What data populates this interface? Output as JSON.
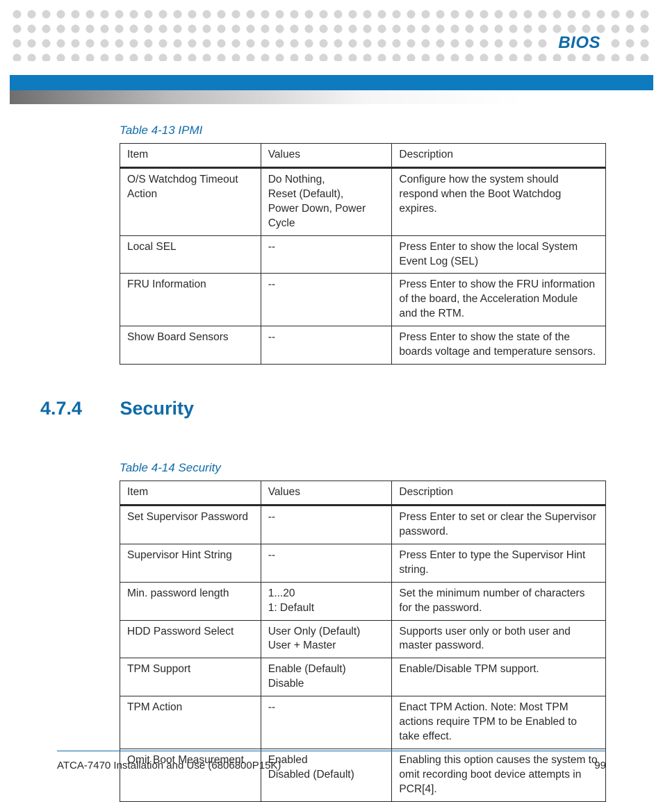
{
  "chapter": "BIOS",
  "section": {
    "number": "4.7.4",
    "title": "Security"
  },
  "table1": {
    "caption": "Table 4-13 IPMI",
    "headers": {
      "c1": "Item",
      "c2": "Values",
      "c3": "Description"
    },
    "rows": [
      {
        "c1": "O/S Watchdog Timeout Action",
        "c2": "Do Nothing,\nReset (Default),\nPower Down, Power Cycle",
        "c3": "Configure how the system should respond when the Boot Watchdog expires."
      },
      {
        "c1": "Local SEL",
        "c2": "--",
        "c3": "Press Enter to show the local System Event Log (SEL)"
      },
      {
        "c1": "FRU Information",
        "c2": "--",
        "c3": "Press Enter to show the FRU information of the board, the Acceleration Module and the RTM."
      },
      {
        "c1": "Show Board Sensors",
        "c2": "--",
        "c3": "Press Enter to show the state of the boards voltage and temperature sensors."
      }
    ]
  },
  "table2": {
    "caption": "Table 4-14 Security",
    "headers": {
      "c1": "Item",
      "c2": "Values",
      "c3": "Description"
    },
    "rows": [
      {
        "c1": "Set Supervisor Password",
        "c2": "--",
        "c3": "Press Enter to set or clear the Supervisor password."
      },
      {
        "c1": "Supervisor Hint String",
        "c2": "--",
        "c3": "Press Enter to type the Supervisor Hint string."
      },
      {
        "c1": "Min. password length",
        "c2": "1...20\n1: Default",
        "c3": "Set the minimum number of characters for the password."
      },
      {
        "c1": "HDD Password Select",
        "c2": "User Only (Default)\nUser + Master",
        "c3": "Supports user only or both user and master password."
      },
      {
        "c1": "TPM Support",
        "c2": "Enable (Default)\nDisable",
        "c3": "Enable/Disable TPM support."
      },
      {
        "c1": "TPM Action",
        "c2": "--",
        "c3": "Enact TPM Action. Note: Most TPM actions require TPM to be Enabled to take effect."
      },
      {
        "c1": "Omit Boot Measurement",
        "c2": "Enabled\nDisabled (Default)",
        "c3": "Enabling this option causes the system to omit recording boot device attempts in PCR[4]."
      }
    ]
  },
  "footer": {
    "doc": "ATCA-7470 Installation and Use (6806800P15K)",
    "page": "99"
  }
}
